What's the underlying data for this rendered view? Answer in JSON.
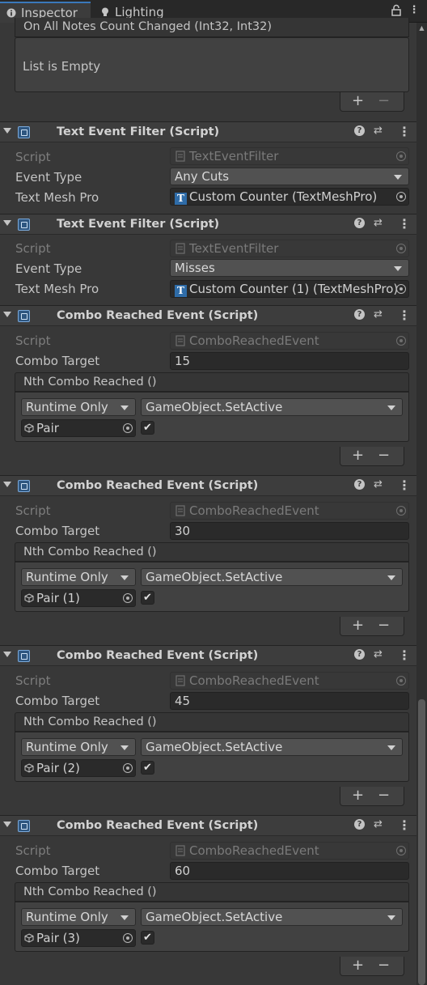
{
  "tabs": {
    "inspector": "Inspector",
    "lighting": "Lighting"
  },
  "top_event": {
    "header": "On All Notes Count Changed (Int32, Int32)",
    "empty_text": "List is Empty"
  },
  "labels": {
    "script": "Script",
    "event_type": "Event Type",
    "text_mesh_pro": "Text Mesh Pro",
    "combo_target": "Combo Target",
    "plus": "+",
    "minus": "−",
    "help": "?",
    "menu": "⋮"
  },
  "text_filters": [
    {
      "title": "Text Event Filter (Script)",
      "script": "TextEventFilter",
      "event_type": "Any Cuts",
      "text_mesh_pro": "Custom Counter (TextMeshPro)"
    },
    {
      "title": "Text Event Filter (Script)",
      "script": "TextEventFilter",
      "event_type": "Misses",
      "text_mesh_pro": "Custom Counter (1) (TextMeshPro)"
    }
  ],
  "combo_events": [
    {
      "title": "Combo Reached Event (Script)",
      "script": "ComboReachedEvent",
      "combo_target": "15",
      "event_header": "Nth Combo Reached ()",
      "runtime": "Runtime Only",
      "function": "GameObject.SetActive",
      "object": "Pair",
      "checked": true
    },
    {
      "title": "Combo Reached Event (Script)",
      "script": "ComboReachedEvent",
      "combo_target": "30",
      "event_header": "Nth Combo Reached ()",
      "runtime": "Runtime Only",
      "function": "GameObject.SetActive",
      "object": "Pair (1)",
      "checked": true
    },
    {
      "title": "Combo Reached Event (Script)",
      "script": "ComboReachedEvent",
      "combo_target": "45",
      "event_header": "Nth Combo Reached ()",
      "runtime": "Runtime Only",
      "function": "GameObject.SetActive",
      "object": "Pair (2)",
      "checked": true
    },
    {
      "title": "Combo Reached Event (Script)",
      "script": "ComboReachedEvent",
      "combo_target": "60",
      "event_header": "Nth Combo Reached ()",
      "runtime": "Runtime Only",
      "function": "GameObject.SetActive",
      "object": "Pair (3)",
      "checked": true
    }
  ],
  "colors": {
    "background": "#383838",
    "tab_accent": "#3a79bb",
    "script_icon": "#2e5680"
  }
}
